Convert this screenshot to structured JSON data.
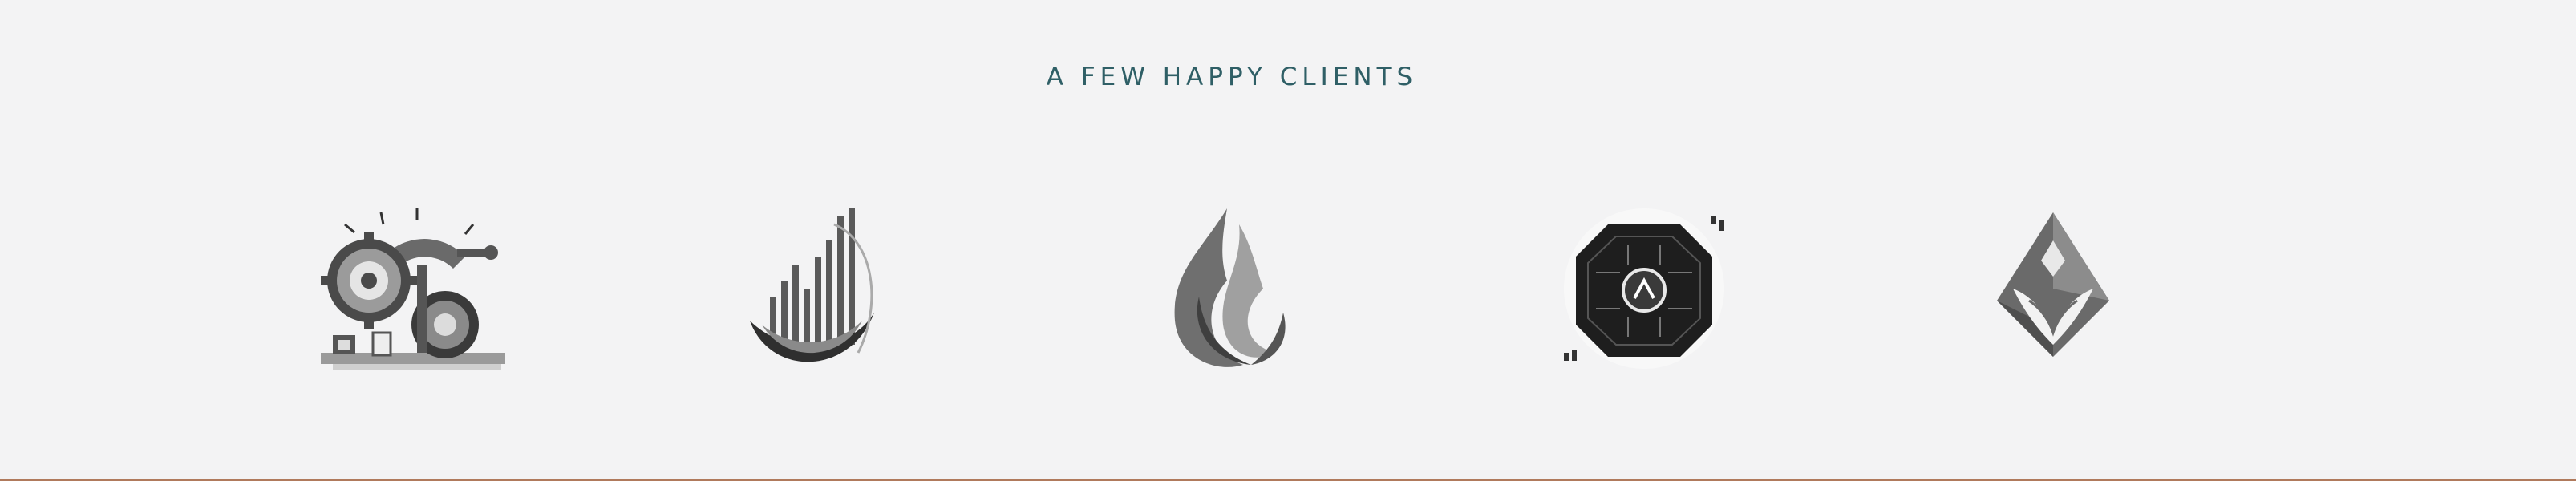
{
  "section": {
    "heading": "A FEW HAPPY CLIENTS"
  },
  "logos": [
    {
      "icon": "gears-machinery-icon"
    },
    {
      "icon": "bar-swirl-icon"
    },
    {
      "icon": "flame-icon"
    },
    {
      "icon": "circuit-chip-icon"
    },
    {
      "icon": "diamond-crest-icon"
    }
  ],
  "colors": {
    "background": "#f3f3f4",
    "heading": "#2f5f66",
    "accent_line": "#b07a5c"
  }
}
